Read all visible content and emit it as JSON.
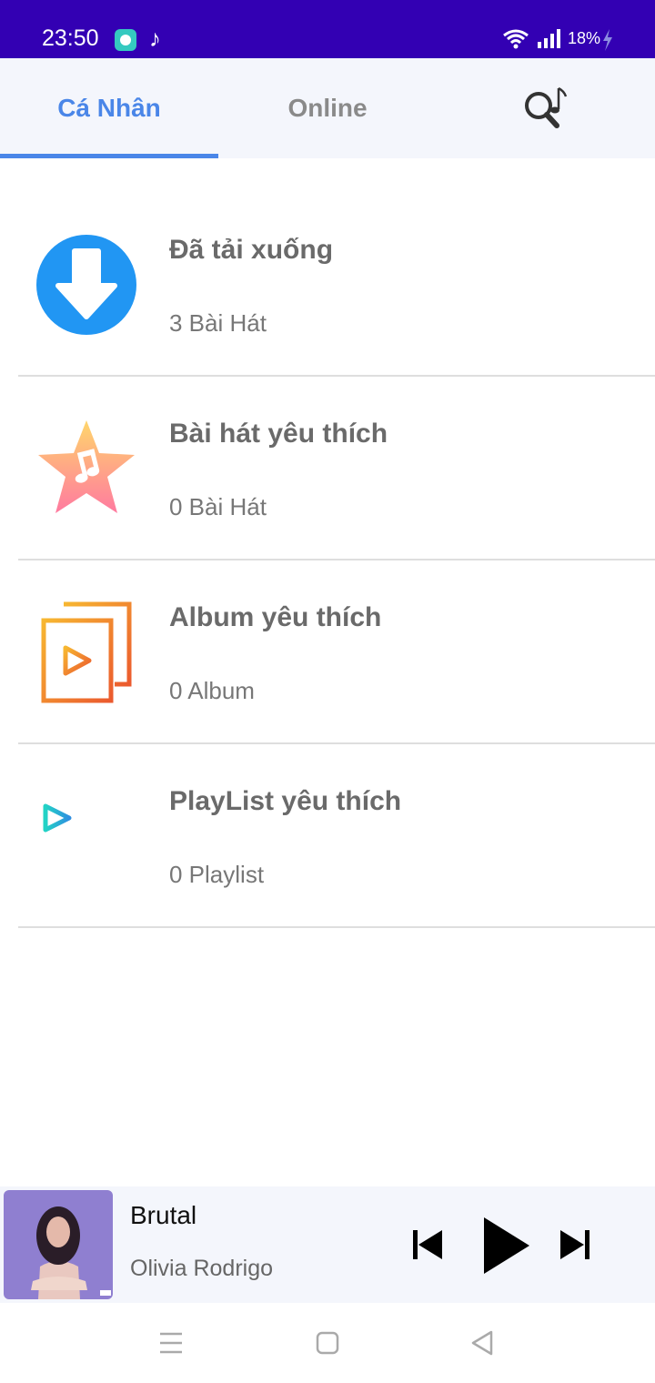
{
  "status_bar": {
    "time": "23:50",
    "battery": "18%",
    "icons": [
      "app-icon",
      "music-note-icon",
      "wifi-icon",
      "signal-icon",
      "charging-bolt-icon"
    ],
    "background": "#3300b3"
  },
  "tabs": [
    {
      "label": "Cá Nhân",
      "active": true
    },
    {
      "label": "Online",
      "active": false
    }
  ],
  "tab_search_icon": "music-search-icon",
  "accent_color": "#4a86e8",
  "library": [
    {
      "title": "Đã tải xuống",
      "subtitle": "3 Bài Hát",
      "icon": "download-icon"
    },
    {
      "title": "Bài hát yêu thích",
      "subtitle": "0 Bài Hát",
      "icon": "star-music-icon"
    },
    {
      "title": "Album yêu thích",
      "subtitle": "0 Album",
      "icon": "album-icon"
    },
    {
      "title": "PlayList yêu thích",
      "subtitle": "0 Playlist",
      "icon": "playlist-icon"
    }
  ],
  "player": {
    "title": "Brutal",
    "artist": "Olivia Rodrigo",
    "controls": [
      "previous-icon",
      "play-icon",
      "next-icon"
    ]
  },
  "navbar": {
    "icons": [
      "menu-icon",
      "home-icon",
      "back-icon"
    ]
  }
}
